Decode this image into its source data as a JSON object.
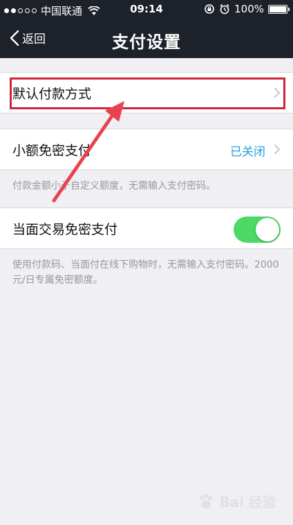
{
  "status_bar": {
    "carrier": "中国联通",
    "time": "09:14",
    "battery": "100%"
  },
  "nav": {
    "back_label": "返回",
    "title": "支付设置"
  },
  "rows": {
    "default_payment": "默认付款方式",
    "small_amount": "小额免密支付",
    "small_amount_value": "已关闭",
    "face_to_face": "当面交易免密支付"
  },
  "notes": {
    "small_amount_note": "付款金额小于自定义额度，无需输入支付密码。",
    "face_to_face_note": "使用付款码、当面付在线下购物时，无需输入支付密码。2000元/日专属免密额度。"
  },
  "toggle": {
    "face_to_face_on": true
  },
  "colors": {
    "nav_bg": "#1d2129",
    "accent": "#1fa2e0",
    "switch_on": "#4cd964",
    "annotation_red": "#d0233a"
  },
  "watermark": {
    "text": "Bai 经验"
  }
}
